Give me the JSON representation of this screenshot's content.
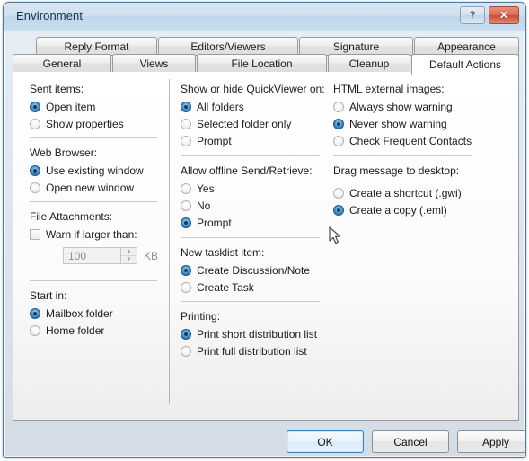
{
  "window": {
    "title": "Environment",
    "help_button": "?",
    "close_button": "✕"
  },
  "tabs": {
    "top_row": [
      {
        "label": "Reply Format",
        "active": false
      },
      {
        "label": "Editors/Viewers",
        "active": false
      },
      {
        "label": "Signature",
        "active": false
      },
      {
        "label": "Appearance",
        "active": false
      }
    ],
    "bottom_row": [
      {
        "label": "General",
        "active": false
      },
      {
        "label": "Views",
        "active": false
      },
      {
        "label": "File Location",
        "active": false
      },
      {
        "label": "Cleanup",
        "active": false
      },
      {
        "label": "Default Actions",
        "active": true
      }
    ]
  },
  "column_left": {
    "sent_items": {
      "label": "Sent items:",
      "options": [
        {
          "label": "Open item",
          "selected": true
        },
        {
          "label": "Show properties",
          "selected": false
        }
      ]
    },
    "web_browser": {
      "label": "Web Browser:",
      "options": [
        {
          "label": "Use existing window",
          "selected": true
        },
        {
          "label": "Open new window",
          "selected": false
        }
      ]
    },
    "file_attachments": {
      "label": "File Attachments:",
      "checkbox": {
        "label": "Warn if larger than:",
        "checked": false
      },
      "spinner": {
        "value": "100",
        "unit": "KB",
        "up": "▲",
        "down": "▼",
        "disabled": true
      }
    },
    "start_in": {
      "label": "Start in:",
      "options": [
        {
          "label": "Mailbox folder",
          "selected": true
        },
        {
          "label": "Home folder",
          "selected": false
        }
      ]
    }
  },
  "column_middle": {
    "quickviewer": {
      "label": "Show or hide QuickViewer on:",
      "options": [
        {
          "label": "All folders",
          "selected": true
        },
        {
          "label": "Selected folder only",
          "selected": false
        },
        {
          "label": "Prompt",
          "selected": false
        }
      ]
    },
    "offline_send_retrieve": {
      "label": "Allow offline Send/Retrieve:",
      "options": [
        {
          "label": "Yes",
          "selected": false
        },
        {
          "label": "No",
          "selected": false
        },
        {
          "label": "Prompt",
          "selected": true
        }
      ]
    },
    "new_tasklist_item": {
      "label": "New tasklist item:",
      "options": [
        {
          "label": "Create Discussion/Note",
          "selected": true
        },
        {
          "label": "Create Task",
          "selected": false
        }
      ]
    },
    "printing": {
      "label": "Printing:",
      "options": [
        {
          "label": "Print short distribution list",
          "selected": true
        },
        {
          "label": "Print full distribution list",
          "selected": false
        }
      ]
    }
  },
  "column_right": {
    "html_external_images": {
      "label": "HTML external images:",
      "options": [
        {
          "label": "Always show warning",
          "selected": false
        },
        {
          "label": "Never show warning",
          "selected": true
        },
        {
          "label": "Check Frequent Contacts",
          "selected": false
        }
      ]
    },
    "drag_message_to_desktop": {
      "label": "Drag message to desktop:",
      "options": [
        {
          "label": "Create a shortcut (.gwi)",
          "selected": false
        },
        {
          "label": "Create a copy (.eml)",
          "selected": true
        }
      ]
    }
  },
  "footer": {
    "ok": "OK",
    "cancel": "Cancel",
    "apply": "Apply"
  },
  "colors": {
    "titlebar_accent": "#bed5ea",
    "close_button": "#cc4b30",
    "radio_selected": "#1d5f99",
    "default_button_border": "#3c7fb1"
  }
}
